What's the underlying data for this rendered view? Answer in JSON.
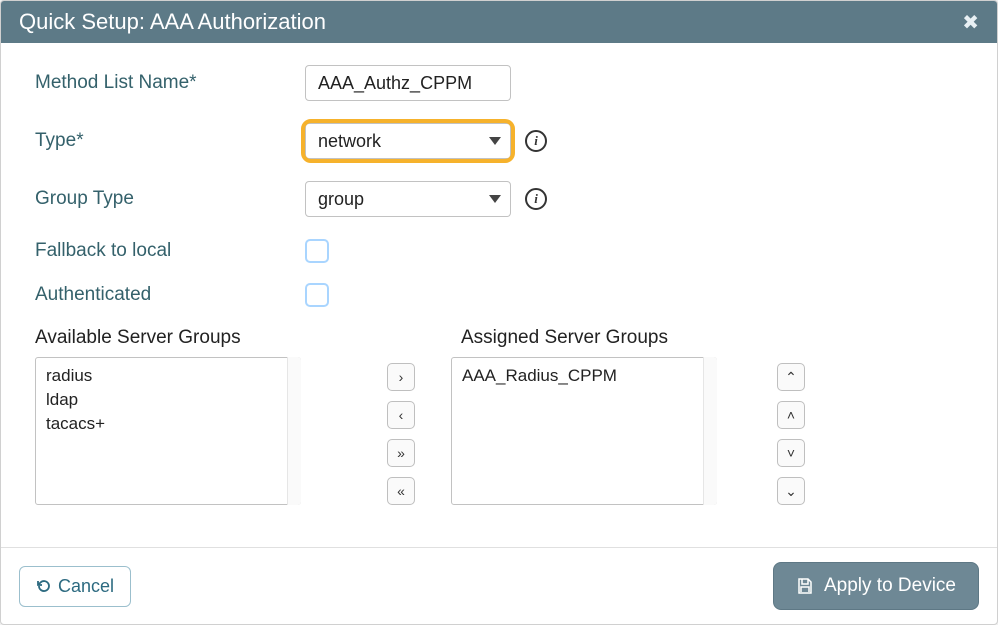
{
  "dialog": {
    "title": "Quick Setup: AAA Authorization",
    "close_glyph": "✖"
  },
  "form": {
    "method_list_name": {
      "label": "Method List Name*",
      "value": "AAA_Authz_CPPM"
    },
    "type": {
      "label": "Type*",
      "value": "network"
    },
    "group_type": {
      "label": "Group Type",
      "value": "group"
    },
    "fallback": {
      "label": "Fallback to local",
      "checked": false
    },
    "authenticated": {
      "label": "Authenticated",
      "checked": false
    }
  },
  "groups": {
    "available_label": "Available Server Groups",
    "assigned_label": "Assigned Server Groups",
    "available": [
      "radius",
      "ldap",
      "tacacs+"
    ],
    "assigned": [
      "AAA_Radius_CPPM"
    ]
  },
  "transfer_glyphs": {
    "add": "›",
    "remove": "‹",
    "add_all": "»",
    "remove_all": "«",
    "top": "⌃",
    "up": "˄",
    "down": "˅",
    "bottom": "⌄"
  },
  "footer": {
    "cancel_label": "Cancel",
    "apply_label": "Apply to Device"
  }
}
